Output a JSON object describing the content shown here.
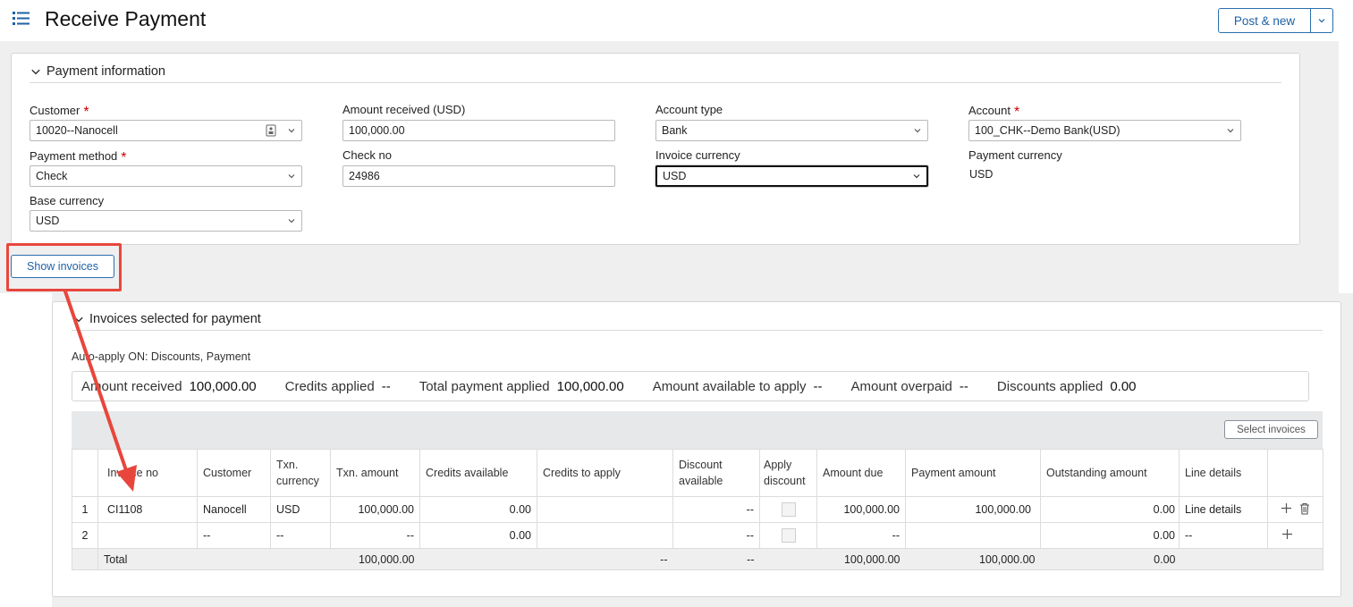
{
  "header": {
    "title": "Receive Payment",
    "post_button": "Post & new"
  },
  "payment_info": {
    "section_title": "Payment information",
    "customer": {
      "label": "Customer",
      "value": "10020--Nanocell"
    },
    "amount_received": {
      "label": "Amount received (USD)",
      "value": "100,000.00"
    },
    "account_type": {
      "label": "Account type",
      "value": "Bank"
    },
    "account": {
      "label": "Account",
      "value": "100_CHK--Demo Bank(USD)"
    },
    "payment_method": {
      "label": "Payment method",
      "value": "Check"
    },
    "check_no": {
      "label": "Check no",
      "value": "24986"
    },
    "invoice_currency": {
      "label": "Invoice currency",
      "value": "USD"
    },
    "payment_currency": {
      "label": "Payment currency",
      "value": "USD"
    },
    "base_currency": {
      "label": "Base currency",
      "value": "USD"
    },
    "required_mark": "*"
  },
  "show_invoices_button": "Show invoices",
  "invoices": {
    "section_title": "Invoices selected for payment",
    "auto_apply": "Auto-apply ON: Discounts, Payment",
    "summary": [
      {
        "label": "Amount received",
        "value": "100,000.00"
      },
      {
        "label": "Credits applied",
        "value": "--"
      },
      {
        "label": "Total payment applied",
        "value": "100,000.00"
      },
      {
        "label": "Amount available to apply",
        "value": "--"
      },
      {
        "label": "Amount overpaid",
        "value": "--"
      },
      {
        "label": "Discounts applied",
        "value": "0.00"
      }
    ],
    "select_invoices_button": "Select invoices",
    "columns": {
      "invoice_no": "Invoice no",
      "customer": "Customer",
      "txn_currency": "Txn. currency",
      "txn_amount": "Txn. amount",
      "credits_available": "Credits available",
      "credits_to_apply": "Credits to apply",
      "discount_available": "Discount available",
      "apply_discount": "Apply discount",
      "amount_due": "Amount due",
      "payment_amount": "Payment amount",
      "outstanding_amount": "Outstanding amount",
      "line_details": "Line details"
    },
    "rows": [
      {
        "num": "1",
        "invoice_no": "CI1108",
        "customer": "Nanocell",
        "txn_currency": "USD",
        "txn_amount": "100,000.00",
        "credits_available": "0.00",
        "credits_to_apply": "",
        "discount_available": "--",
        "amount_due": "100,000.00",
        "payment_amount": "100,000.00",
        "outstanding_amount": "0.00",
        "line_details": "Line details"
      },
      {
        "num": "2",
        "invoice_no": "",
        "customer": "--",
        "txn_currency": "--",
        "txn_amount": "--",
        "credits_available": "0.00",
        "credits_to_apply": "",
        "discount_available": "--",
        "amount_due": "--",
        "payment_amount": "",
        "outstanding_amount": "0.00",
        "line_details": "--"
      }
    ],
    "total": {
      "label": "Total",
      "txn_amount": "100,000.00",
      "credits_to_apply": "--",
      "discount_available": "--",
      "amount_due": "100,000.00",
      "payment_amount": "100,000.00",
      "outstanding_amount": "0.00"
    }
  },
  "annotation_color": "#e8463c",
  "accent_color": "#1d62a5"
}
